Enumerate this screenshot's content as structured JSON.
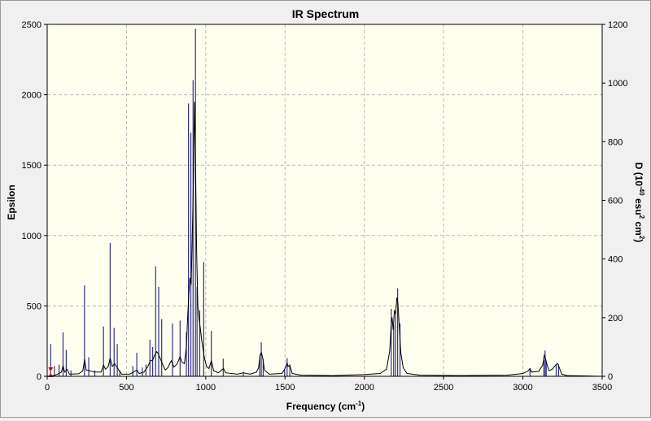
{
  "chart_data": {
    "type": "line",
    "title": "IR Spectrum",
    "xlabel_main": "Frequency (cm",
    "xlabel_sup": "-1",
    "xlabel_end": ")",
    "ylabel_left": "Epsilon",
    "ylabel_right": {
      "p1": "D (10",
      "sup1": "-40",
      "p2": " esu",
      "sup2": "2",
      "p3": " cm",
      "sup3": "2",
      "p4": ")"
    },
    "xlim": [
      0,
      3500
    ],
    "ylim_left": [
      0,
      2500
    ],
    "ylim_right": [
      0,
      1200
    ],
    "x_ticks": [
      0,
      500,
      1000,
      1500,
      2000,
      2500,
      3000,
      3500
    ],
    "y_left_ticks": [
      0,
      500,
      1000,
      1500,
      2000,
      2500
    ],
    "y_right_ticks": [
      0,
      200,
      400,
      600,
      800,
      1000,
      1200
    ],
    "grid": true,
    "colors": {
      "plot_bg": "#fffff0",
      "spectrum": "#000000",
      "sticks": "#2f2f8f",
      "grid": "#b8b8b8",
      "marker": "#cc0000"
    },
    "marker_x": 22,
    "sticks": [
      [
        22,
        110
      ],
      [
        45,
        35
      ],
      [
        75,
        40
      ],
      [
        100,
        150
      ],
      [
        120,
        90
      ],
      [
        150,
        20
      ],
      [
        235,
        310
      ],
      [
        262,
        65
      ],
      [
        300,
        20
      ],
      [
        355,
        170
      ],
      [
        397,
        455
      ],
      [
        422,
        165
      ],
      [
        442,
        110
      ],
      [
        458,
        20
      ],
      [
        540,
        35
      ],
      [
        565,
        80
      ],
      [
        600,
        30
      ],
      [
        623,
        40
      ],
      [
        648,
        125
      ],
      [
        665,
        100
      ],
      [
        684,
        375
      ],
      [
        703,
        305
      ],
      [
        722,
        195
      ],
      [
        790,
        180
      ],
      [
        838,
        190
      ],
      [
        878,
        150
      ],
      [
        891,
        930
      ],
      [
        906,
        830
      ],
      [
        920,
        1010
      ],
      [
        935,
        1185
      ],
      [
        945,
        305
      ],
      [
        962,
        225
      ],
      [
        987,
        390
      ],
      [
        1035,
        155
      ],
      [
        1110,
        60
      ],
      [
        1237,
        15
      ],
      [
        1340,
        65
      ],
      [
        1350,
        115
      ],
      [
        1362,
        60
      ],
      [
        1497,
        25
      ],
      [
        1513,
        62
      ],
      [
        1530,
        35
      ],
      [
        2170,
        230
      ],
      [
        2185,
        175
      ],
      [
        2197,
        215
      ],
      [
        2210,
        300
      ],
      [
        2225,
        180
      ],
      [
        3045,
        28
      ],
      [
        3132,
        55
      ],
      [
        3140,
        88
      ],
      [
        3147,
        50
      ],
      [
        3210,
        38
      ],
      [
        3225,
        40
      ]
    ],
    "spectrum": [
      [
        0,
        0
      ],
      [
        40,
        5
      ],
      [
        60,
        12
      ],
      [
        90,
        30
      ],
      [
        100,
        75
      ],
      [
        110,
        30
      ],
      [
        125,
        50
      ],
      [
        140,
        15
      ],
      [
        200,
        18
      ],
      [
        225,
        40
      ],
      [
        236,
        120
      ],
      [
        246,
        45
      ],
      [
        300,
        30
      ],
      [
        340,
        30
      ],
      [
        355,
        80
      ],
      [
        368,
        50
      ],
      [
        385,
        70
      ],
      [
        397,
        130
      ],
      [
        410,
        70
      ],
      [
        425,
        90
      ],
      [
        442,
        60
      ],
      [
        470,
        15
      ],
      [
        520,
        15
      ],
      [
        545,
        30
      ],
      [
        565,
        45
      ],
      [
        580,
        20
      ],
      [
        610,
        30
      ],
      [
        635,
        70
      ],
      [
        650,
        110
      ],
      [
        665,
        115
      ],
      [
        678,
        150
      ],
      [
        690,
        175
      ],
      [
        700,
        160
      ],
      [
        712,
        130
      ],
      [
        730,
        80
      ],
      [
        745,
        45
      ],
      [
        760,
        60
      ],
      [
        782,
        110
      ],
      [
        800,
        65
      ],
      [
        820,
        90
      ],
      [
        838,
        140
      ],
      [
        850,
        100
      ],
      [
        865,
        90
      ],
      [
        878,
        210
      ],
      [
        886,
        420
      ],
      [
        893,
        580
      ],
      [
        900,
        700
      ],
      [
        908,
        650
      ],
      [
        915,
        1000
      ],
      [
        922,
        1400
      ],
      [
        929,
        1950
      ],
      [
        935,
        1550
      ],
      [
        942,
        900
      ],
      [
        950,
        500
      ],
      [
        958,
        400
      ],
      [
        965,
        350
      ],
      [
        975,
        250
      ],
      [
        990,
        140
      ],
      [
        1005,
        70
      ],
      [
        1020,
        55
      ],
      [
        1035,
        110
      ],
      [
        1050,
        40
      ],
      [
        1080,
        25
      ],
      [
        1100,
        45
      ],
      [
        1112,
        55
      ],
      [
        1125,
        25
      ],
      [
        1200,
        15
      ],
      [
        1237,
        25
      ],
      [
        1280,
        15
      ],
      [
        1320,
        30
      ],
      [
        1333,
        60
      ],
      [
        1342,
        150
      ],
      [
        1350,
        170
      ],
      [
        1358,
        140
      ],
      [
        1370,
        45
      ],
      [
        1400,
        15
      ],
      [
        1480,
        20
      ],
      [
        1495,
        45
      ],
      [
        1503,
        65
      ],
      [
        1513,
        95
      ],
      [
        1520,
        70
      ],
      [
        1530,
        80
      ],
      [
        1545,
        20
      ],
      [
        1600,
        8
      ],
      [
        1800,
        5
      ],
      [
        2000,
        12
      ],
      [
        2100,
        20
      ],
      [
        2140,
        50
      ],
      [
        2160,
        180
      ],
      [
        2168,
        350
      ],
      [
        2175,
        420
      ],
      [
        2182,
        330
      ],
      [
        2190,
        470
      ],
      [
        2197,
        440
      ],
      [
        2205,
        560
      ],
      [
        2212,
        520
      ],
      [
        2220,
        360
      ],
      [
        2230,
        170
      ],
      [
        2245,
        60
      ],
      [
        2270,
        20
      ],
      [
        2350,
        8
      ],
      [
        2600,
        5
      ],
      [
        2900,
        8
      ],
      [
        3000,
        20
      ],
      [
        3030,
        35
      ],
      [
        3045,
        55
      ],
      [
        3055,
        30
      ],
      [
        3100,
        35
      ],
      [
        3125,
        80
      ],
      [
        3135,
        150
      ],
      [
        3142,
        130
      ],
      [
        3150,
        90
      ],
      [
        3165,
        40
      ],
      [
        3185,
        50
      ],
      [
        3200,
        70
      ],
      [
        3210,
        85
      ],
      [
        3220,
        90
      ],
      [
        3230,
        60
      ],
      [
        3245,
        15
      ],
      [
        3280,
        5
      ],
      [
        3500,
        0
      ]
    ]
  }
}
